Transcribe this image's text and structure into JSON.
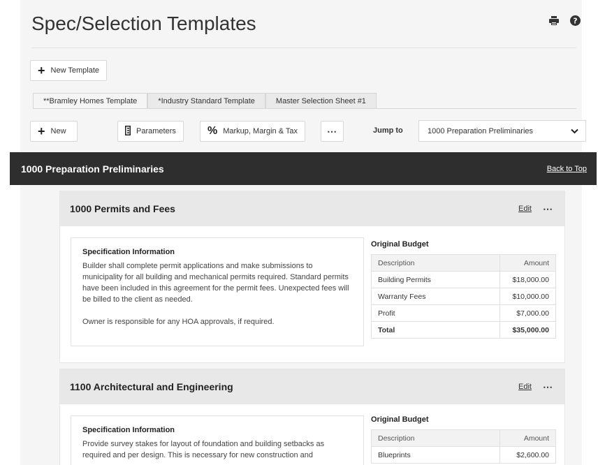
{
  "page": {
    "title": "Spec/Selection Templates"
  },
  "toolbar": {
    "new_template_label": "New Template",
    "new_label": "New",
    "parameters_label": "Parameters",
    "markup_label": "Markup, Margin & Tax",
    "more_label": "⋯",
    "jump_label": "Jump to",
    "jump_value": "1000 Preparation Preliminaries"
  },
  "tabs": [
    {
      "label": "**Bramley Homes Template",
      "active": true
    },
    {
      "label": "*Industry Standard Template",
      "active": false
    },
    {
      "label": "Master Selection Sheet #1",
      "active": false
    }
  ],
  "section": {
    "title": "1000 Preparation Preliminaries",
    "back_to_top": "Back to Top"
  },
  "items": [
    {
      "title": "1000 Permits and Fees",
      "edit_label": "Edit",
      "more_label": "⋯",
      "spec_heading": "Specification Information",
      "spec_text": "Builder shall complete permit applications and make submissions to municipality for all building and mechanical permits required. Standard permits have been included in this agreement for the permit fees. Unexpected fees will be billed to the client as needed.\n\nOwner is responsible for any HOA approvals, if required.",
      "budget_title": "Original Budget",
      "budget_headers": [
        "Description",
        "Amount"
      ],
      "budget_rows": [
        {
          "description": "Building Permits",
          "amount": "$18,000.00"
        },
        {
          "description": "Warranty Fees",
          "amount": "$10,000.00"
        },
        {
          "description": "Profit",
          "amount": "$7,000.00"
        }
      ],
      "budget_total": {
        "description": "Total",
        "amount": "$35,000.00"
      }
    },
    {
      "title": "1100 Architectural and Engineering",
      "edit_label": "Edit",
      "more_label": "⋯",
      "spec_heading": "Specification Information",
      "spec_text": "Provide survey stakes for layout of foundation and building setbacks as required and per design. This is necessary for new construction and",
      "budget_title": "Original Budget",
      "budget_headers": [
        "Description",
        "Amount"
      ],
      "budget_rows": [
        {
          "description": "Blueprints",
          "amount": "$2,600.00"
        }
      ]
    }
  ]
}
